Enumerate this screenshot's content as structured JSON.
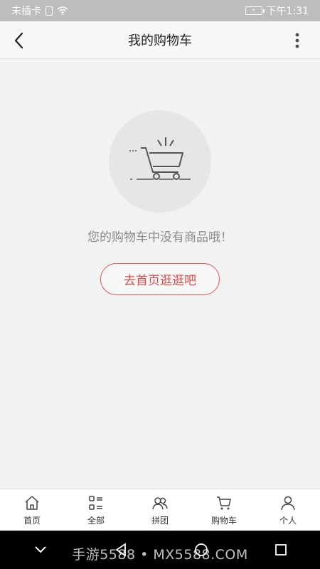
{
  "status_bar": {
    "carrier": "未插卡",
    "time": "下午1:31"
  },
  "header": {
    "title": "我的购物车"
  },
  "empty_state": {
    "message": "您的购物车中没有商品哦！",
    "action_label": "去首页逛逛吧"
  },
  "tabs": [
    {
      "label": "首页",
      "icon": "home-icon"
    },
    {
      "label": "全部",
      "icon": "category-icon"
    },
    {
      "label": "拼团",
      "icon": "group-icon"
    },
    {
      "label": "购物车",
      "icon": "cart-icon"
    },
    {
      "label": "个人",
      "icon": "person-icon"
    }
  ],
  "watermark": "手游5588 • MX5588.COM",
  "colors": {
    "accent": "#e05a5a",
    "status_bg": "#bdbdbd",
    "page_bg": "#f2f2f2"
  }
}
